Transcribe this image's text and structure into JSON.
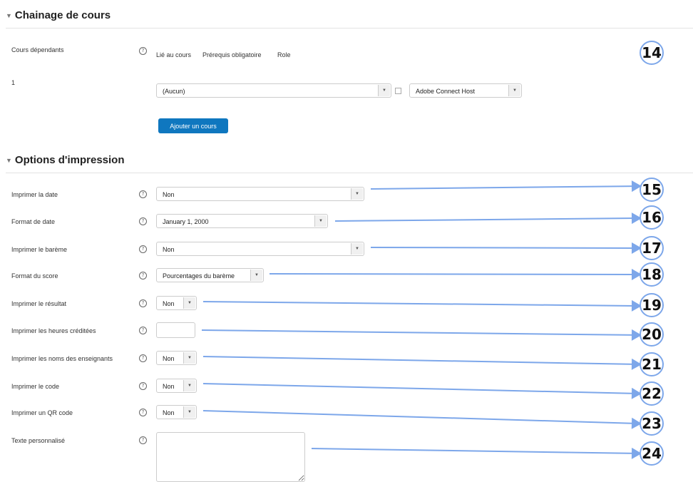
{
  "sections": {
    "chaining": "Chainage de cours",
    "printing": "Options d'impression"
  },
  "chaining": {
    "dependent_label": "Cours dépendants",
    "col_linked": "Lié au cours",
    "col_prereq": "Prérequis obligatoire",
    "col_role": "Role",
    "row_index": "1",
    "course_select": "(Aucun)",
    "role_select": "Adobe Connect Host",
    "add_button": "Ajouter un cours"
  },
  "print_options": {
    "print_date_label": "Imprimer la date",
    "print_date_value": "Non",
    "date_format_label": "Format de date",
    "date_format_value": "January 1, 2000",
    "print_scale_label": "Imprimer le barème",
    "print_scale_value": "Non",
    "score_format_label": "Format du score",
    "score_format_value": "Pourcentages du barème",
    "print_result_label": "Imprimer le résultat",
    "print_result_value": "Non",
    "credit_hours_label": "Imprimer les heures créditées",
    "credit_hours_value": "",
    "teachers_label": "Imprimer les noms des enseignants",
    "teachers_value": "Non",
    "code_label": "Imprimer le code",
    "code_value": "Non",
    "qr_label": "Imprimer un QR code",
    "qr_value": "Non",
    "custom_text_label": "Texte personnalisé",
    "custom_text_value": ""
  },
  "help_glyph": "?",
  "callouts": [
    "14",
    "15",
    "16",
    "17",
    "18",
    "19",
    "20",
    "21",
    "22",
    "23",
    "24"
  ],
  "colors": {
    "accent_button": "#0f77bf",
    "callout_arrow": "#7da7ea"
  }
}
